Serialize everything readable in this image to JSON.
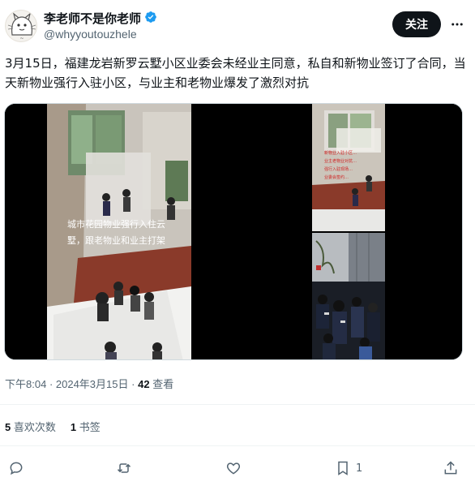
{
  "author": {
    "display_name": "李老师不是你老师",
    "handle": "@whyyoutouzhele",
    "verified": true
  },
  "header": {
    "follow_label": "关注",
    "more_icon": "more-icon"
  },
  "tweet": {
    "text": "3月15日，福建龙岩新罗云墅小区业委会未经业主同意，私自和新物业签订了合同，当天新物业强行入驻小区，与业主和老物业爆发了激烈对抗",
    "media_caption_1": "城市花园物业强行入住云",
    "media_caption_2": "墅，跟老物业和业主打架"
  },
  "meta": {
    "time": "下午8:04",
    "date": "2024年3月15日",
    "views_count": "42",
    "views_label": "查看"
  },
  "stats": {
    "likes_count": "5",
    "likes_label": "喜欢次数",
    "bookmarks_count": "1",
    "bookmarks_label": "书签"
  },
  "actions": {
    "bookmark_count": "1"
  },
  "colors": {
    "accent": "#1d9bf0",
    "text": "#0f1419",
    "secondary": "#536471"
  }
}
